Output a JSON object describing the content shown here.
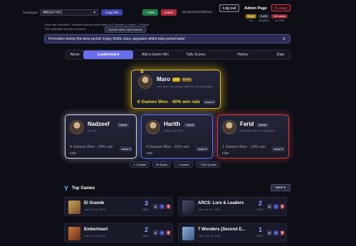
{
  "header": {
    "campaign_label": "Campaign:",
    "campaign_value": "MBGGTH21",
    "copy_link": "Copy link",
    "new_label": "+ New",
    "leave_label": "Leave",
    "email": "georgcsbyyz@gmail....",
    "logout": "Log out",
    "admin_page": "Admin Page",
    "admin_badge": "Admin",
    "stats": [
      {
        "chip": "Royal",
        "label": "ranc"
      },
      {
        "chip": "4 of 5",
        "label": "campaigns"
      },
      {
        "chip": "999 weeks",
        "label": "per week"
      }
    ]
  },
  "info": {
    "line1": "There are currently 2 Travelers and an active party of 2 Wonder (1 Noble / 1 Royal)",
    "line2": "This campaign accepts everyone.",
    "update_btn": "Update class requirements"
  },
  "promo": {
    "text": "Promotion during this beta period: Enjoy Noble class upgrades whilst beta period lasts!",
    "close": "✕"
  },
  "tabs": {
    "about": "About",
    "leaderboard": "Leaderboard",
    "add": "Add a Game Win",
    "tally": "Tally Scores",
    "history": "History",
    "data": "Data"
  },
  "leader": {
    "name": "Maro",
    "badge1": "YOU",
    "badge2": "ROYAL",
    "tagline": "One does not simply walk into my campaign.",
    "wins": "6 Games Won · 40% win rate",
    "more": "more ▾"
  },
  "players": [
    {
      "name": "Nadzeef",
      "badge": "Traveler",
      "tag": "Zeh ay.",
      "wins": "4 Games Won · 33% win rate",
      "more": "more ▾"
    },
    {
      "name": "Harith",
      "badge": "Traveler",
      "tag": "Whats up, Dev?",
      "wins": "4 Games Won · 31% win rate",
      "more": "more ▾"
    },
    {
      "name": "Farid",
      "badge": "Traveler",
      "tag": "Momydenam is it ezygstzin.",
      "wins": "1 Games Won · 10% win rate",
      "more": "more ▾"
    }
  ],
  "chips": [
    "Confetti",
    "Shake",
    "Fanfare",
    "Roll Quotes"
  ],
  "topgames": {
    "title": "Top Games",
    "more": "More ▾",
    "wins_label": "WINS",
    "items": [
      {
        "name": "El Grande",
        "date": "Last: Feb 6, 2026",
        "wins": "3"
      },
      {
        "name": "ARCS: Lore & Leaders",
        "date": "Last: Jan 21, 2026",
        "wins": "2"
      },
      {
        "name": "Emberheart",
        "date": "Last: Feb 6, 2026",
        "wins": "2"
      },
      {
        "name": "7 Wonders (Second E...",
        "date": "Last: Feb 25, 2026",
        "wins": "1"
      }
    ]
  },
  "colors": {
    "accent": "#6c6ef0",
    "gold": "#e8c21a",
    "silver": "#d8d8e6",
    "blue": "#5a6ee8",
    "red": "#d83a44"
  }
}
